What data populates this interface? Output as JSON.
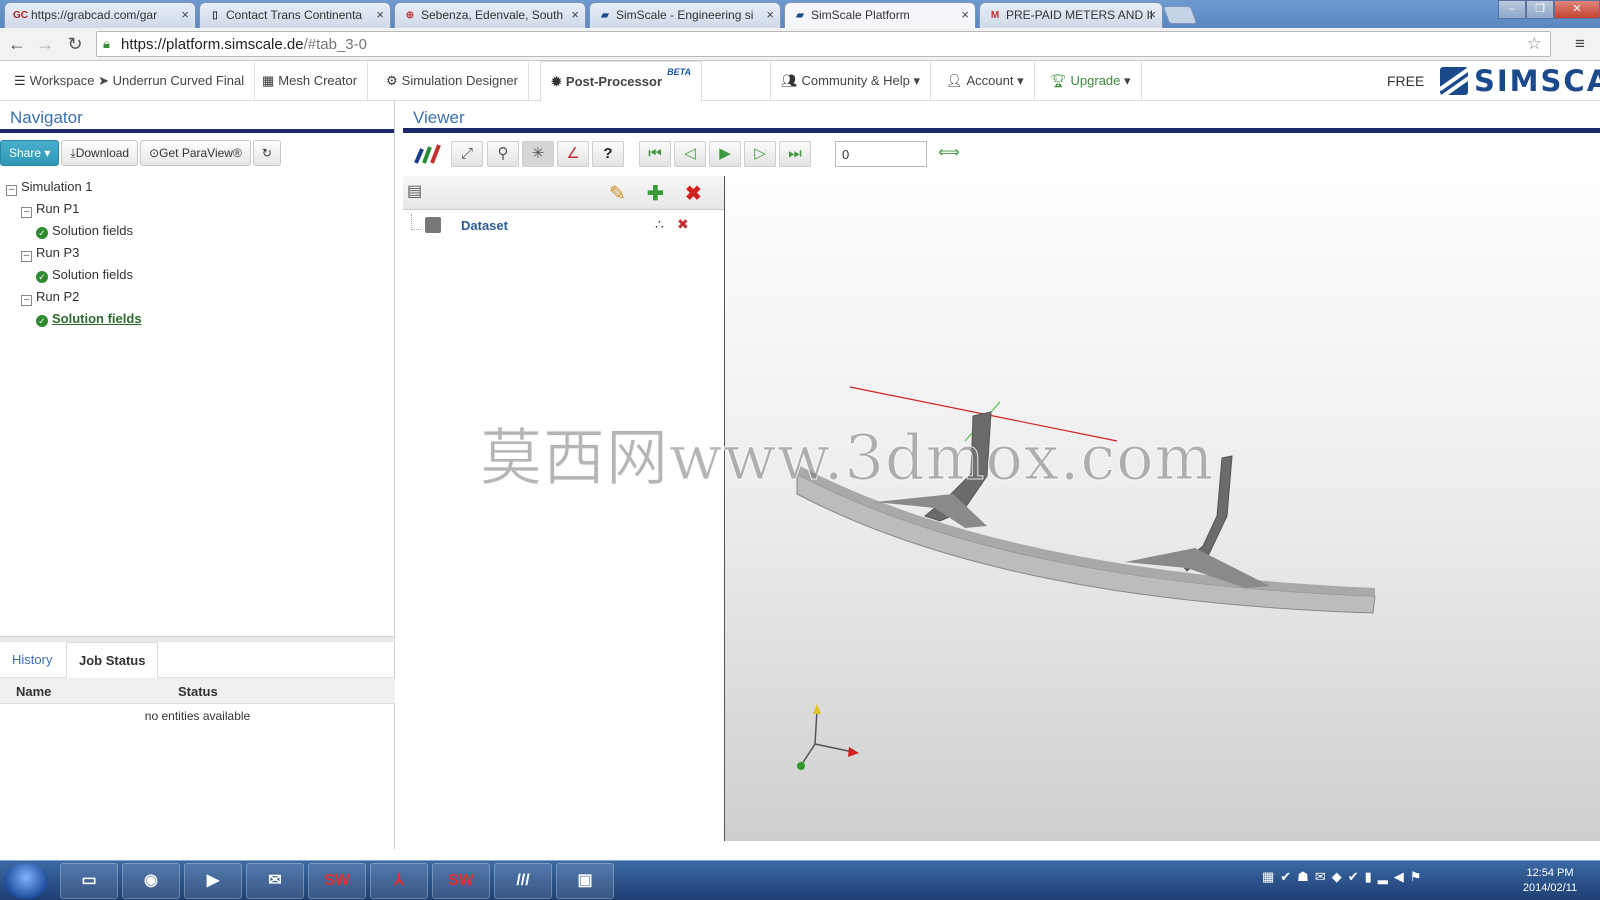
{
  "browser": {
    "tabs": [
      {
        "favicon": "GC",
        "label": "https://grabcad.com/gar"
      },
      {
        "favicon": "page-icon",
        "label": "Contact Trans Continenta"
      },
      {
        "favicon": "map-icon",
        "label": "Sebenza, Edenvale, South"
      },
      {
        "favicon": "simscale-icon",
        "label": "SimScale - Engineering si"
      },
      {
        "favicon": "simscale-icon",
        "label": "SimScale Platform"
      },
      {
        "favicon": "gmail-icon",
        "label": "PRE-PAID METERS AND II"
      }
    ],
    "url_host": "https://platform.simscale.de",
    "url_path": "/#tab_3-0"
  },
  "header": {
    "workspace_label": "Workspace",
    "project_name": "Underrun Curved Final",
    "mesh_creator": "Mesh Creator",
    "simulation_designer": "Simulation Designer",
    "post_processor": "Post-Processor",
    "beta": "BETA",
    "community": "Community & Help",
    "account": "Account",
    "upgrade": "Upgrade",
    "plan": "FREE",
    "logo": "SIMSCALE"
  },
  "navigator": {
    "title": "Navigator",
    "share": "Share",
    "download": "Download",
    "paraview": "Get ParaView®",
    "tree": {
      "root": "Simulation 1",
      "runs": [
        {
          "name": "Run P1",
          "child": "Solution fields"
        },
        {
          "name": "Run P3",
          "child": "Solution fields"
        },
        {
          "name": "Run P2",
          "child": "Solution fields"
        }
      ]
    },
    "bottom_tabs": {
      "history": "History",
      "job_status": "Job Status"
    },
    "job_table": {
      "col_name": "Name",
      "col_status": "Status",
      "empty": "no entities available"
    }
  },
  "viewer": {
    "title": "Viewer",
    "frame": "0",
    "dataset_label": "Dataset",
    "watermark": "莫西网www.3dmox.com"
  },
  "taskbar": {
    "apps": [
      "explorer",
      "chrome",
      "media-player",
      "outlook",
      "SW",
      "acrobat",
      "SW",
      "paraview",
      "remote-desktop"
    ],
    "time": "12:54 PM",
    "date": "2014/02/11"
  },
  "colors": {
    "accent": "#3b70b0",
    "brand": "#1a4a8c",
    "header_rule": "#1a2a6c",
    "ok_green": "#2f8a2f"
  }
}
